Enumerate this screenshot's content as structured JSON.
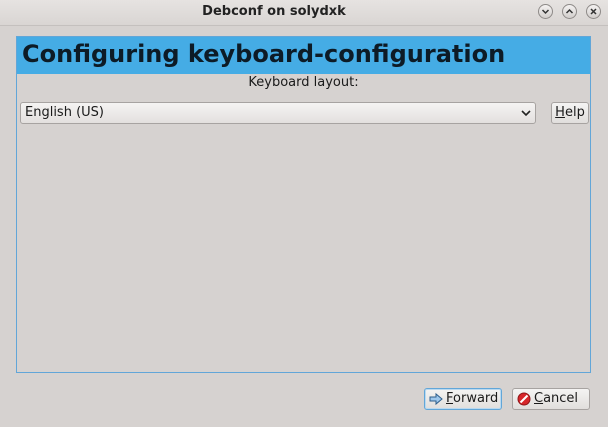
{
  "window": {
    "title": "Debconf on solydxk",
    "controls": [
      "minimize-icon",
      "maximize-icon",
      "close-icon"
    ]
  },
  "panel": {
    "heading": "Configuring keyboard-configuration",
    "field_label": "Keyboard layout:",
    "layout_select": {
      "selected": "English (US)"
    },
    "help_button": {
      "label": "Help",
      "mnemonic": "H",
      "rest": "elp"
    }
  },
  "footer": {
    "forward_button": {
      "label": "Forward",
      "mnemonic": "F",
      "rest": "orward",
      "icon": "arrow-right-icon"
    },
    "cancel_button": {
      "label": "Cancel",
      "mnemonic": "C",
      "rest": "ancel",
      "icon": "cancel-icon"
    }
  },
  "colors": {
    "banner": "#45ace5",
    "panel_border": "#62a6d8",
    "window_bg": "#d6d2d0"
  }
}
